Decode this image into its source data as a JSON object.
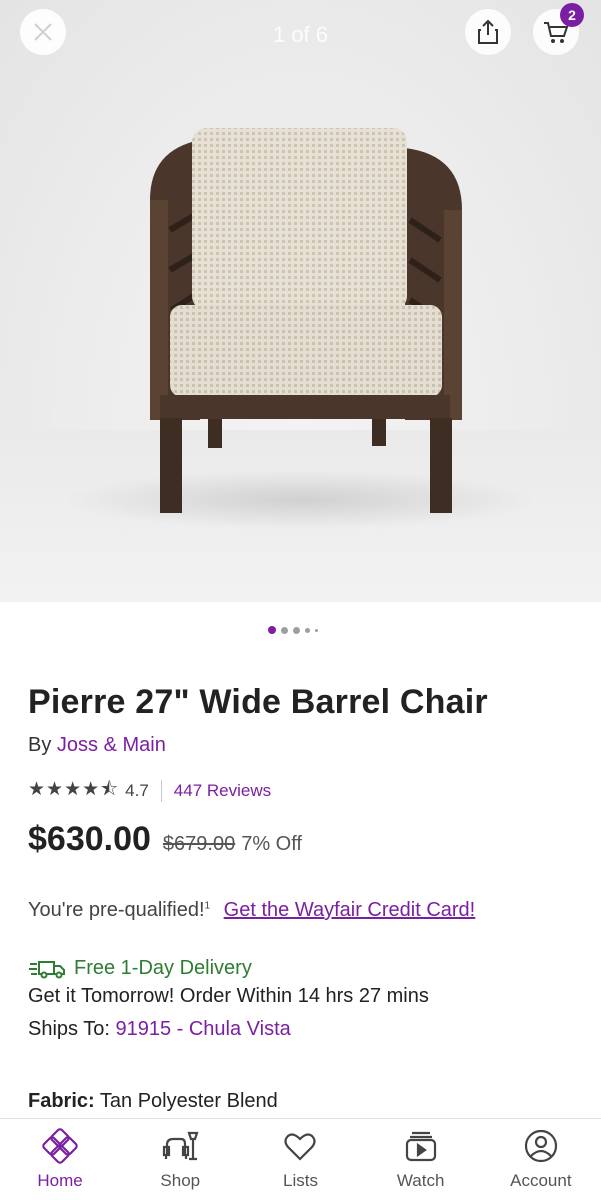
{
  "header": {
    "image_counter": "1 of 6",
    "cart_count": "2"
  },
  "product": {
    "title": "Pierre 27\" Wide Barrel Chair",
    "by_prefix": "By",
    "brand": "Joss & Main",
    "stars": "★★★★⯪",
    "rating": "4.7",
    "reviews": "447 Reviews",
    "price": "$630.00",
    "old_price": "$679.00",
    "discount": "7% Off",
    "prequalified": "You're pre-qualified!",
    "prequalified_mark": "1",
    "credit_link": "Get the Wayfair Credit Card!",
    "delivery": "Free 1-Day Delivery",
    "get_it": "Get it Tomorrow! Order Within 14 hrs 27 mins",
    "ships_label": "Ships To:",
    "ships_zip": "91915 - Chula Vista",
    "fabric_label": "Fabric:",
    "fabric_value": "Tan Polyester Blend"
  },
  "nav": {
    "items": [
      {
        "label": "Home",
        "icon": "home-icon"
      },
      {
        "label": "Shop",
        "icon": "shop-icon"
      },
      {
        "label": "Lists",
        "icon": "heart-icon"
      },
      {
        "label": "Watch",
        "icon": "watch-icon"
      },
      {
        "label": "Account",
        "icon": "account-icon"
      }
    ]
  },
  "colors": {
    "accent": "#7b1fa2",
    "delivery": "#2e7d32"
  }
}
